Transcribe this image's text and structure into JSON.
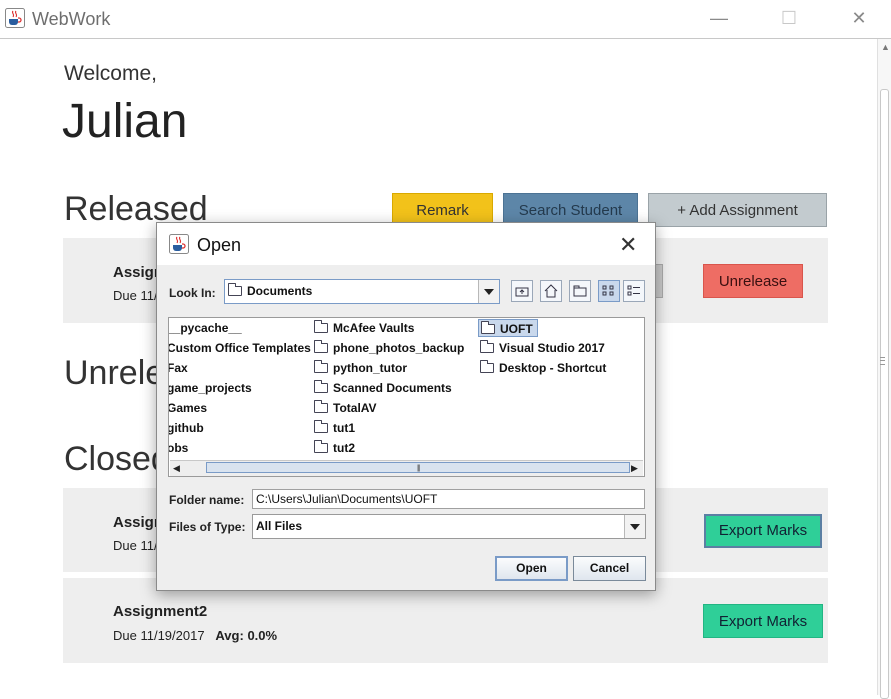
{
  "window": {
    "title": "WebWork",
    "minimize": "—",
    "maximize": "☐",
    "close": "✕"
  },
  "welcome": {
    "greeting": "Welcome,",
    "name": "Julian"
  },
  "sections": {
    "released": "Released",
    "unreleased": "Unrele",
    "closed": "Closed"
  },
  "toolbar": {
    "remark": "Remark",
    "search_student": "Search Student",
    "add_assignment": "+ Add Assignment"
  },
  "colors": {
    "remark": "#f2c21a",
    "search": "#5d86a8",
    "add": "#c3cbcf",
    "unrelease": "#ee6d64",
    "export": "#2fcf98"
  },
  "released_items": [
    {
      "name": "Assign",
      "due": "Due 11/",
      "action": "Unrelease"
    }
  ],
  "closed_items": [
    {
      "name": "Assign",
      "due": "Due 11/",
      "action": "Export Marks"
    },
    {
      "name": "Assignment2",
      "due": "Due 11/19/2017",
      "avg_label": "Avg:",
      "avg_value": "0.0%",
      "action": "Export Marks"
    }
  ],
  "dialog": {
    "title": "Open",
    "close": "✕",
    "look_in_label": "Look In:",
    "look_in_value": "Documents",
    "toolbar_icons": [
      "up-folder-icon",
      "home-icon",
      "new-folder-icon",
      "list-view-icon",
      "details-view-icon"
    ],
    "files": [
      {
        "name": "__pycache__",
        "folder": false,
        "selected": false
      },
      {
        "name": "Custom Office Templates",
        "folder": false,
        "selected": false
      },
      {
        "name": "Fax",
        "folder": false,
        "selected": false
      },
      {
        "name": "game_projects",
        "folder": false,
        "selected": false
      },
      {
        "name": "Games",
        "folder": false,
        "selected": false
      },
      {
        "name": "github",
        "folder": false,
        "selected": false
      },
      {
        "name": "obs",
        "folder": false,
        "selected": false
      },
      {
        "name": "McAfee Vaults",
        "folder": true,
        "selected": false
      },
      {
        "name": "phone_photos_backup",
        "folder": true,
        "selected": false
      },
      {
        "name": "python_tutor",
        "folder": true,
        "selected": false
      },
      {
        "name": "Scanned Documents",
        "folder": true,
        "selected": false
      },
      {
        "name": "TotalAV",
        "folder": true,
        "selected": false
      },
      {
        "name": "tut1",
        "folder": true,
        "selected": false
      },
      {
        "name": "tut2",
        "folder": true,
        "selected": false
      },
      {
        "name": "UOFT",
        "folder": true,
        "selected": true
      },
      {
        "name": "Visual Studio 2017",
        "folder": true,
        "selected": false
      },
      {
        "name": "Desktop - Shortcut",
        "folder": true,
        "selected": false
      }
    ],
    "folder_name_label": "Folder name:",
    "folder_name_value": "C:\\Users\\Julian\\Documents\\UOFT",
    "files_of_type_label": "Files of Type:",
    "files_of_type_value": "All Files",
    "open_button": "Open",
    "cancel_button": "Cancel"
  }
}
